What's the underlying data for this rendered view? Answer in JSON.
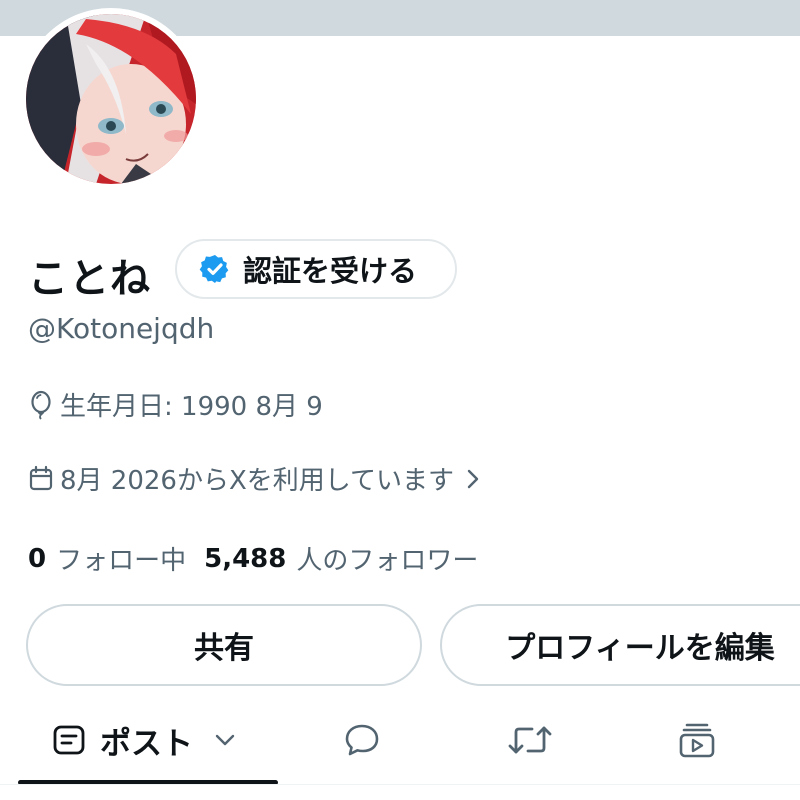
{
  "colors": {
    "accent": "#1d9bf0",
    "secondary_text": "#536471",
    "primary_text": "#0f1419",
    "banner": "#cfd9de"
  },
  "profile": {
    "display_name": "ことね",
    "verify_button_label": "認証を受ける",
    "handle": "@Kotonejqdh",
    "birth_date": "生年月日: 1990 8月 9",
    "joined": "8月 2026からXを利用しています",
    "following_count": "0",
    "following_label": "フォロー中",
    "followers_count": "5,488",
    "followers_label": "人のフォロワー"
  },
  "actions": {
    "share_label": "共有",
    "edit_profile_label": "プロフィールを編集"
  },
  "tabs": [
    {
      "label": "ポスト",
      "icon": "post-icon",
      "selected": true
    },
    {
      "label": "",
      "icon": "reply-bubble-icon"
    },
    {
      "label": "",
      "icon": "repost-icon"
    },
    {
      "label": "",
      "icon": "media-icon"
    }
  ]
}
